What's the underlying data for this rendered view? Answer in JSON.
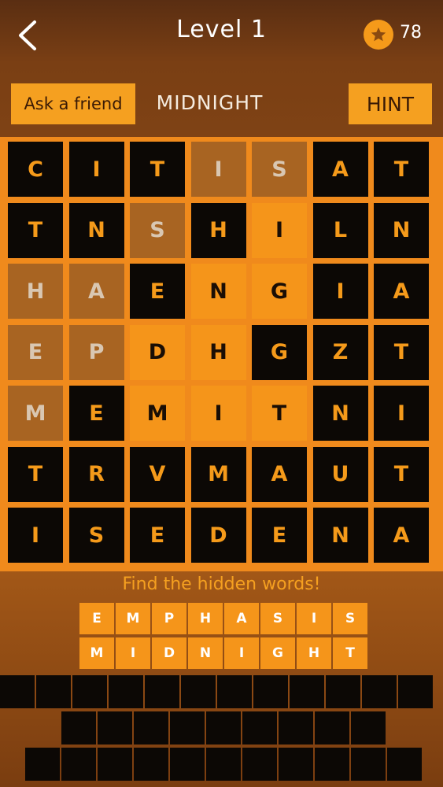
{
  "header": {
    "title": "Level 1",
    "coins": "78"
  },
  "toolbar": {
    "ask_label": "Ask a friend",
    "current_word": "MIDNIGHT",
    "hint_label": "HINT"
  },
  "grid": [
    [
      {
        "l": "C",
        "s": "dark"
      },
      {
        "l": "I",
        "s": "dark"
      },
      {
        "l": "T",
        "s": "dark"
      },
      {
        "l": "I",
        "s": "dim"
      },
      {
        "l": "S",
        "s": "dim"
      },
      {
        "l": "A",
        "s": "dark"
      },
      {
        "l": "T",
        "s": "dark"
      }
    ],
    [
      {
        "l": "T",
        "s": "dark"
      },
      {
        "l": "N",
        "s": "dark"
      },
      {
        "l": "S",
        "s": "dim"
      },
      {
        "l": "H",
        "s": "dark"
      },
      {
        "l": "I",
        "s": "found"
      },
      {
        "l": "L",
        "s": "dark"
      },
      {
        "l": "N",
        "s": "dark"
      }
    ],
    [
      {
        "l": "H",
        "s": "dim"
      },
      {
        "l": "A",
        "s": "dim"
      },
      {
        "l": "E",
        "s": "dark"
      },
      {
        "l": "N",
        "s": "found"
      },
      {
        "l": "G",
        "s": "found"
      },
      {
        "l": "I",
        "s": "dark"
      },
      {
        "l": "A",
        "s": "dark"
      }
    ],
    [
      {
        "l": "E",
        "s": "dim"
      },
      {
        "l": "P",
        "s": "dim"
      },
      {
        "l": "D",
        "s": "found"
      },
      {
        "l": "H",
        "s": "found"
      },
      {
        "l": "G",
        "s": "dark"
      },
      {
        "l": "Z",
        "s": "dark"
      },
      {
        "l": "T",
        "s": "dark"
      }
    ],
    [
      {
        "l": "M",
        "s": "dim"
      },
      {
        "l": "E",
        "s": "dark"
      },
      {
        "l": "M",
        "s": "found"
      },
      {
        "l": "I",
        "s": "found"
      },
      {
        "l": "T",
        "s": "found"
      },
      {
        "l": "N",
        "s": "dark"
      },
      {
        "l": "I",
        "s": "dark"
      }
    ],
    [
      {
        "l": "T",
        "s": "dark"
      },
      {
        "l": "R",
        "s": "dark"
      },
      {
        "l": "V",
        "s": "dark"
      },
      {
        "l": "M",
        "s": "dark"
      },
      {
        "l": "A",
        "s": "dark"
      },
      {
        "l": "U",
        "s": "dark"
      },
      {
        "l": "T",
        "s": "dark"
      }
    ],
    [
      {
        "l": "I",
        "s": "dark"
      },
      {
        "l": "S",
        "s": "dark"
      },
      {
        "l": "E",
        "s": "dark"
      },
      {
        "l": "D",
        "s": "dark"
      },
      {
        "l": "E",
        "s": "dark"
      },
      {
        "l": "N",
        "s": "dark"
      },
      {
        "l": "A",
        "s": "dark"
      }
    ]
  ],
  "instructions": "Find the hidden words!",
  "found_words": [
    [
      "E",
      "M",
      "P",
      "H",
      "A",
      "S",
      "I",
      "S"
    ],
    [
      "M",
      "I",
      "D",
      "N",
      "I",
      "G",
      "H",
      "T"
    ]
  ],
  "colors": {
    "accent": "#f5a020",
    "tile_dark": "#0c0805",
    "found": "#f5951a"
  }
}
